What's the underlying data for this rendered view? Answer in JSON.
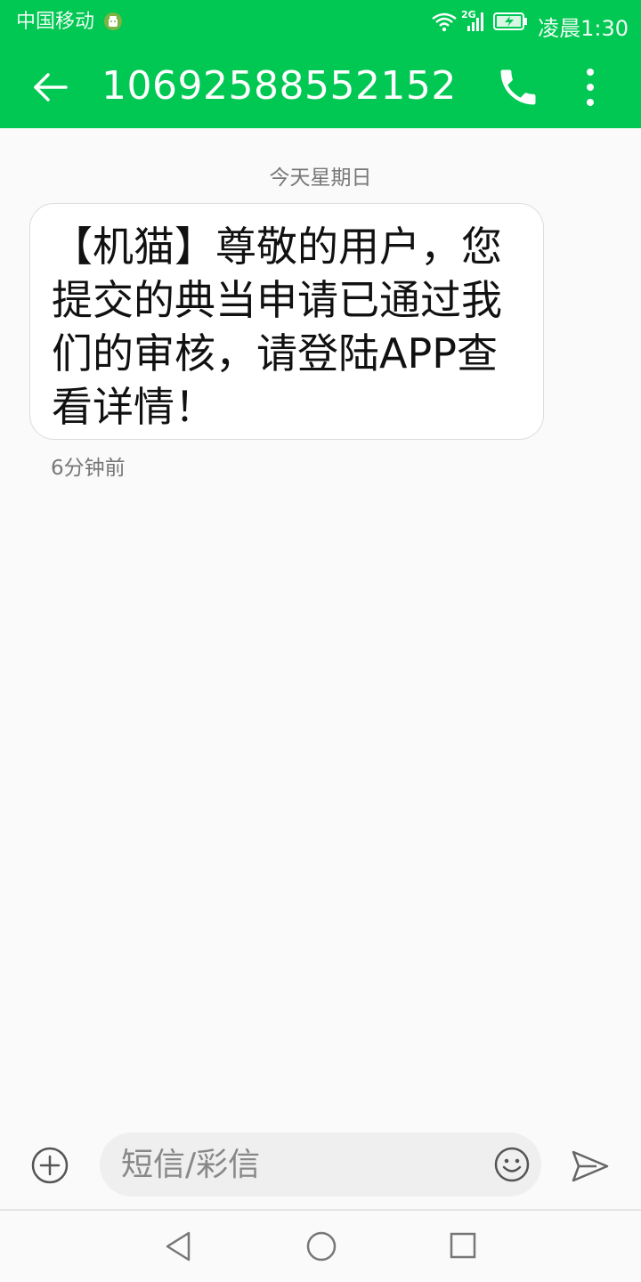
{
  "status_bar": {
    "carrier": "中国移动",
    "carrier_icon": "android-robot-icon",
    "wifi_icon": "wifi-icon",
    "network_type": "2G",
    "signal_icon": "signal-icon",
    "battery_icon": "battery-charging-icon",
    "time": "凌晨1:30"
  },
  "header": {
    "back_icon": "arrow-left-icon",
    "title": "10692588552152",
    "call_icon": "phone-icon",
    "more_icon": "more-vertical-icon",
    "background_color": "#00c853"
  },
  "conversation": {
    "date_divider": "今天星期日",
    "messages": [
      {
        "text": "【机猫】尊敬的用户，您提交的典当申请已通过我们的审核，请登陆APP查看详情！",
        "time": "6分钟前"
      }
    ]
  },
  "composer": {
    "add_icon": "plus-circle-icon",
    "input_value": "",
    "input_placeholder": "短信/彩信",
    "emoji_icon": "smiley-icon",
    "send_icon": "send-icon"
  },
  "navbar": {
    "back_icon": "triangle-back-icon",
    "home_icon": "circle-home-icon",
    "recent_icon": "square-recents-icon"
  }
}
